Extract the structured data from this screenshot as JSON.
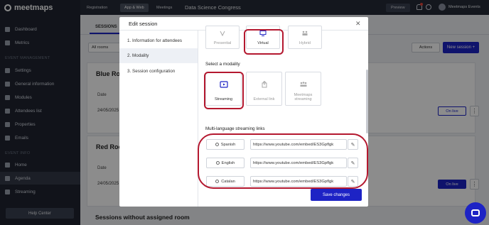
{
  "brand": {
    "name": "meetmaps",
    "accent": "#1d23c5",
    "highlight": "#b4182f"
  },
  "sidebar": {
    "items": [
      {
        "label": "Dashboard",
        "icon": "dashboard-icon"
      },
      {
        "label": "Metrics",
        "icon": "metrics-icon"
      }
    ],
    "section_event_management": "EVENT MANAGEMENT",
    "management_items": [
      {
        "label": "Settings",
        "icon": "gear-icon"
      },
      {
        "label": "General information",
        "icon": "info-icon"
      },
      {
        "label": "Modules",
        "icon": "modules-icon"
      },
      {
        "label": "Attendees list",
        "icon": "users-icon"
      },
      {
        "label": "Properties",
        "icon": "properties-icon"
      },
      {
        "label": "Emails",
        "icon": "email-icon"
      }
    ],
    "section_event_info": "EVENT INFO",
    "info_items": [
      {
        "label": "Home",
        "icon": "home-icon"
      },
      {
        "label": "Agenda",
        "icon": "agenda-icon"
      },
      {
        "label": "Streaming",
        "icon": "streaming-icon"
      }
    ],
    "help_label": "Help Center"
  },
  "topbar": {
    "tabs": [
      "Registration",
      "App & Web",
      "Meetings"
    ],
    "event_title": "Data Science Congress",
    "preview_label": "Preview",
    "user_name": "Meetmaps Events"
  },
  "main": {
    "sessions_tab": "SESSIONS",
    "all_rooms": "All rooms",
    "actions": "Actions",
    "new_session": "New session +",
    "rooms": [
      {
        "title": "Blue Room",
        "date_col": "Date",
        "date": "24/05/2025",
        "live": "On live"
      },
      {
        "title": "Red Room",
        "date_col": "Date",
        "date": "24/05/2025",
        "live": "On live"
      }
    ],
    "no_room_title": "Sessions without assigned room"
  },
  "modal": {
    "title": "Edit session",
    "steps": [
      "1. Information for attendees",
      "2. Modality",
      "3. Session configuration"
    ],
    "type_options": [
      {
        "label": "Presential",
        "icon": "presential-icon"
      },
      {
        "label": "Virtual",
        "icon": "monitor-icon"
      },
      {
        "label": "Hybrid",
        "icon": "hybrid-icon"
      }
    ],
    "select_modality_title": "Select a modality",
    "modality_options": [
      {
        "label": "Streaming",
        "icon": "streaming-icon"
      },
      {
        "label": "External link",
        "icon": "external-link-icon"
      },
      {
        "label": "Meetmaps streaming",
        "icon": "group-icon"
      }
    ],
    "multi_lang_title": "Multi-language streaming links",
    "languages": [
      {
        "label": "Spanish",
        "url": "https://www.youtube.com/embed/ES3Gpflgk"
      },
      {
        "label": "English",
        "url": "https://www.youtube.com/embed/ES3Gpflgk"
      },
      {
        "label": "Catalan",
        "url": "https://www.youtube.com/embed/ES3Gpflgk"
      }
    ],
    "save_label": "Save changes"
  }
}
